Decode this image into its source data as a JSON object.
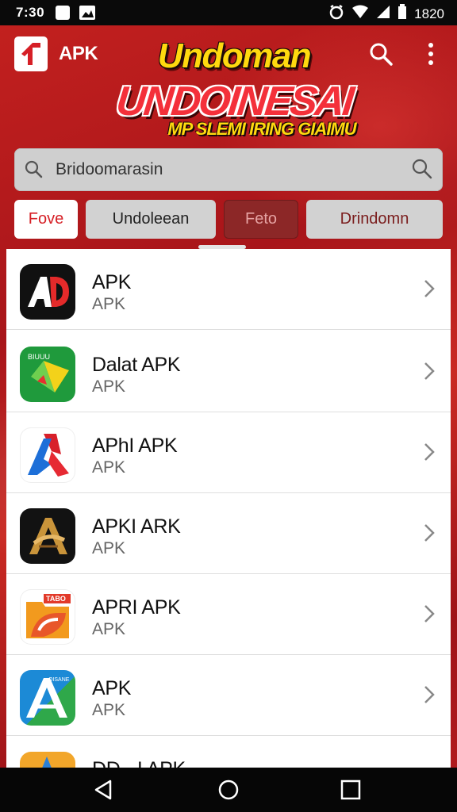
{
  "status_bar": {
    "time": "7:30",
    "clock": "1820"
  },
  "app_bar": {
    "brand": "APK"
  },
  "banner": {
    "line1": "Undoman",
    "line2": "UNDOINESAI",
    "line3": "MP SLEMI IRING GIAIMU"
  },
  "search": {
    "value": "Bridoomarasin"
  },
  "chips": [
    "Fove",
    "Undoleean",
    "Feto",
    "Drindomn"
  ],
  "apps": [
    {
      "title": "APK",
      "subtitle": "APK",
      "icon": "ad-logo-icon"
    },
    {
      "title": "Dalat APK",
      "subtitle": "APK",
      "icon": "green-map-icon"
    },
    {
      "title": "APhI APK",
      "subtitle": "APK",
      "icon": "red-blue-a-icon"
    },
    {
      "title": "APKI ARK",
      "subtitle": "APK",
      "icon": "gold-a-icon"
    },
    {
      "title": "APRI APK",
      "subtitle": "APK",
      "icon": "orange-folder-icon"
    },
    {
      "title": "APK",
      "subtitle": "APK",
      "icon": "blue-a-icon"
    },
    {
      "title": "DD - I APK",
      "subtitle": "",
      "icon": "partial-icon"
    }
  ],
  "icon_badges": {
    "app2": "BIUUU",
    "app5": "TABO",
    "app6": "OISANE"
  },
  "colors": {
    "brand_red": "#c4211f",
    "accent_yellow": "#ffd90f",
    "chip_active": "#d61f26"
  }
}
